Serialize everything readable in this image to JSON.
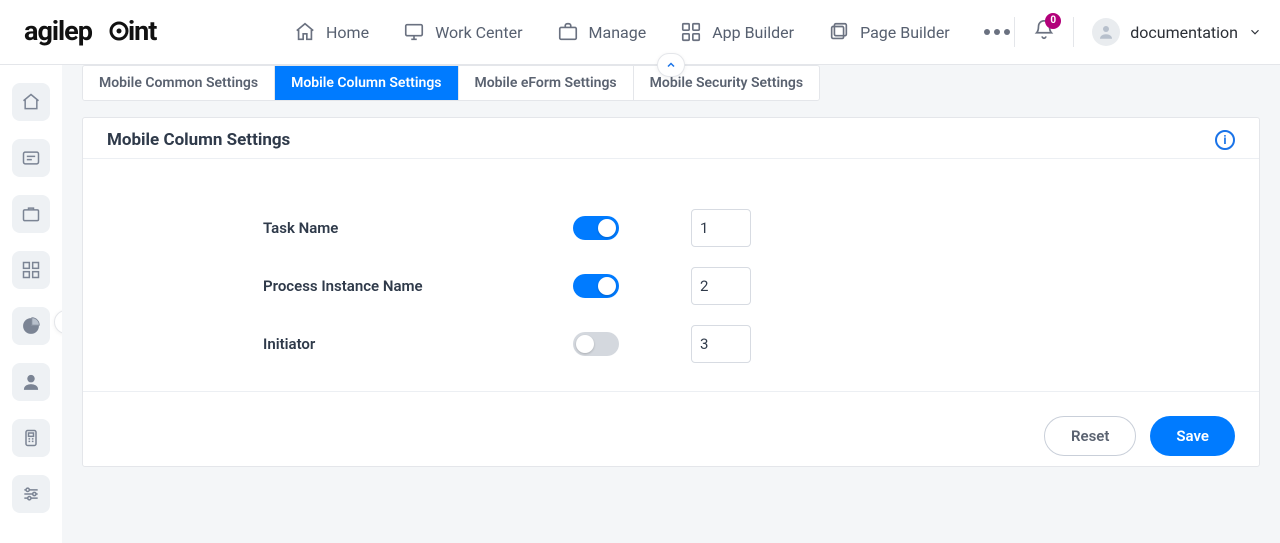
{
  "header": {
    "logo_text": "agilepoint",
    "nav": [
      {
        "label": "Home",
        "icon": "home-icon"
      },
      {
        "label": "Work Center",
        "icon": "monitor-icon"
      },
      {
        "label": "Manage",
        "icon": "briefcase-icon"
      },
      {
        "label": "App Builder",
        "icon": "apps-icon"
      },
      {
        "label": "Page Builder",
        "icon": "layers-icon"
      }
    ],
    "notifications": {
      "count": "0"
    },
    "user": {
      "name": "documentation"
    }
  },
  "siderail": {
    "items": [
      "home",
      "list",
      "briefcase",
      "apps",
      "chart",
      "user",
      "device",
      "sliders"
    ]
  },
  "tabs": [
    {
      "label": "Mobile Common Settings",
      "active": false
    },
    {
      "label": "Mobile Column Settings",
      "active": true
    },
    {
      "label": "Mobile eForm Settings",
      "active": false
    },
    {
      "label": "Mobile Security Settings",
      "active": false
    }
  ],
  "panel": {
    "title": "Mobile Column Settings",
    "rows": [
      {
        "label": "Task Name",
        "enabled": true,
        "order": "1"
      },
      {
        "label": "Process Instance Name",
        "enabled": true,
        "order": "2"
      },
      {
        "label": "Initiator",
        "enabled": false,
        "order": "3"
      }
    ],
    "footer": {
      "reset": "Reset",
      "save": "Save"
    }
  }
}
